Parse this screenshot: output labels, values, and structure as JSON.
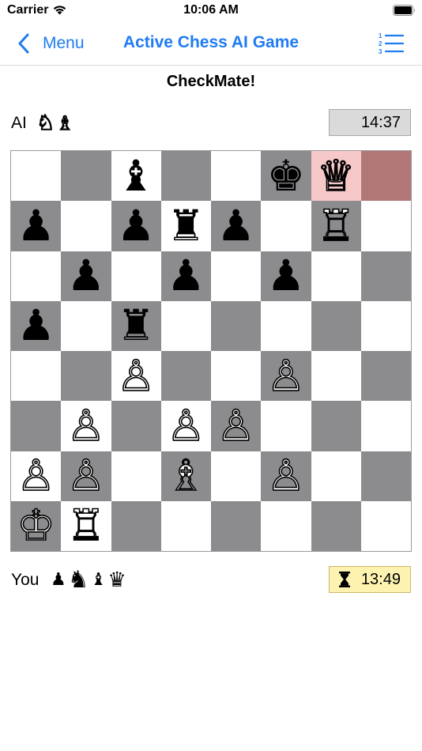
{
  "status_bar": {
    "carrier": "Carrier",
    "time": "10:06 AM",
    "icons": [
      "wifi-icon",
      "battery-icon"
    ]
  },
  "nav": {
    "back_label": "Menu",
    "title": "Active Chess AI Game",
    "back_icon": "chevron-left-icon",
    "list_icon": "numbered-list-icon",
    "accent_color": "#1f7cf2"
  },
  "game_status": "CheckMate!",
  "opponent": {
    "name": "AI",
    "captured": [
      "♘",
      "♗"
    ],
    "timer": "14:37"
  },
  "player": {
    "name": "You",
    "captured": [
      "♟",
      "♞",
      "♝",
      "♛"
    ],
    "timer": "13:49",
    "timer_icon": "hourglass-icon"
  },
  "board": {
    "colors": {
      "light": "#ffffff",
      "dark": "#8c8c8f",
      "highlight_light": "#f7c8c8",
      "highlight_dark": "#b27878"
    },
    "highlighted": [
      [
        0,
        6
      ],
      [
        0,
        7
      ]
    ],
    "rows": [
      [
        "",
        "",
        "♝",
        "",
        "",
        "♚",
        "♕",
        ""
      ],
      [
        "♟",
        "",
        "♟",
        "♜",
        "♟",
        "",
        "♖",
        ""
      ],
      [
        "",
        "♟",
        "",
        "♟",
        "",
        "♟",
        "",
        ""
      ],
      [
        "♟",
        "",
        "♜",
        "",
        "",
        "",
        "",
        ""
      ],
      [
        "",
        "",
        "♙",
        "",
        "",
        "♙",
        "",
        ""
      ],
      [
        "",
        "♙",
        "",
        "♙",
        "♙",
        "",
        "",
        ""
      ],
      [
        "♙",
        "♙",
        "",
        "♗",
        "",
        "♙",
        "",
        ""
      ],
      [
        "♔",
        "♖",
        "",
        "",
        "",
        "",
        "",
        ""
      ]
    ]
  }
}
